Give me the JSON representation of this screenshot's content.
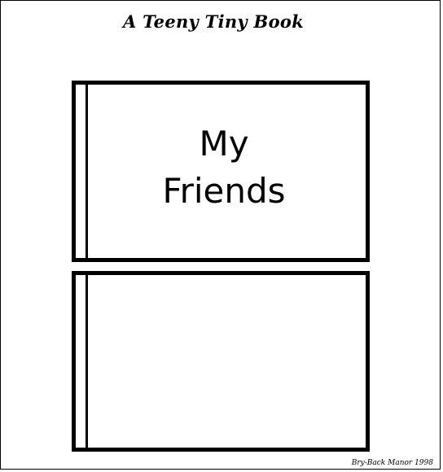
{
  "header": {
    "title": "A Teeny Tiny Book"
  },
  "cover": {
    "title_line1": "My",
    "title_line2": "Friends"
  },
  "footer": {
    "credit": "Bry-Back Manor 1998"
  }
}
